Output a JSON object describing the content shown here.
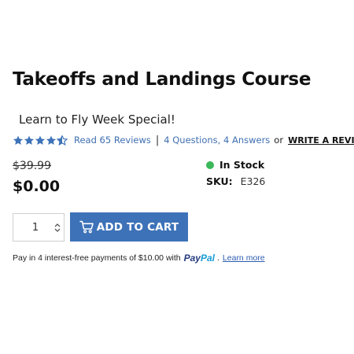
{
  "product": {
    "title": "Takeoffs and Landings Course",
    "subtitle": "Learn to Fly Week Special!",
    "rating": 4.5,
    "rating_max": 5,
    "reviews_link": "Read 65 Reviews",
    "separator": "|",
    "questions_link": "4 Questions, 4 Answers",
    "or_text": "or",
    "write_review": "WRITE A REVIEW",
    "old_price": "$39.99",
    "price": "$0.00",
    "stock_status": "In Stock",
    "sku_label": "SKU:",
    "sku_value": "E326"
  },
  "cart": {
    "quantity": "1",
    "add_to_cart_label": "ADD TO CART"
  },
  "paypal": {
    "message": "Pay in 4 interest-free payments of $10.00 with",
    "logo_pay": "Pay",
    "logo_pal": "Pal",
    "period": ".",
    "learn_more": "Learn more"
  },
  "colors": {
    "star": "#3d72b8",
    "link": "#3f6fb0",
    "button": "#3d72b8",
    "in_stock": "#3bb85a"
  },
  "icons": [
    "star-icon",
    "half-star-icon",
    "status-dot-icon",
    "cart-icon",
    "spinner-arrows-icon"
  ]
}
